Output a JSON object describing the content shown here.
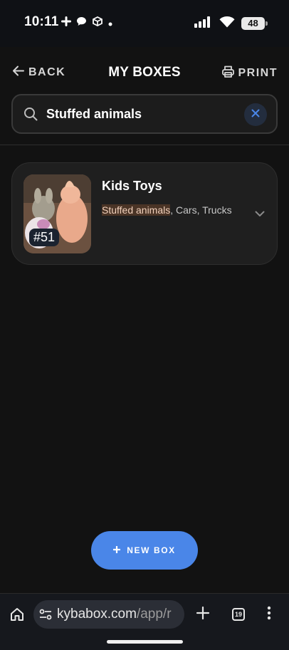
{
  "status_bar": {
    "time": "10:11",
    "battery": "48"
  },
  "header": {
    "back_label": "BACK",
    "title": "MY BOXES",
    "print_label": "PRINT"
  },
  "search": {
    "value": "Stuffed animals"
  },
  "boxes": [
    {
      "title": "Kids Toys",
      "number": "#51",
      "matched_tag": "Stuffed animals",
      "other_tags": ", Cars, Trucks"
    }
  ],
  "new_box_label": "NEW BOX",
  "browser": {
    "url_domain": "kybabox.com",
    "url_path": "/app/r",
    "tab_count": "19"
  },
  "colors": {
    "accent": "#4a86e8",
    "background": "#121212",
    "card": "#1f1f1f",
    "highlight": "#4a3426"
  }
}
